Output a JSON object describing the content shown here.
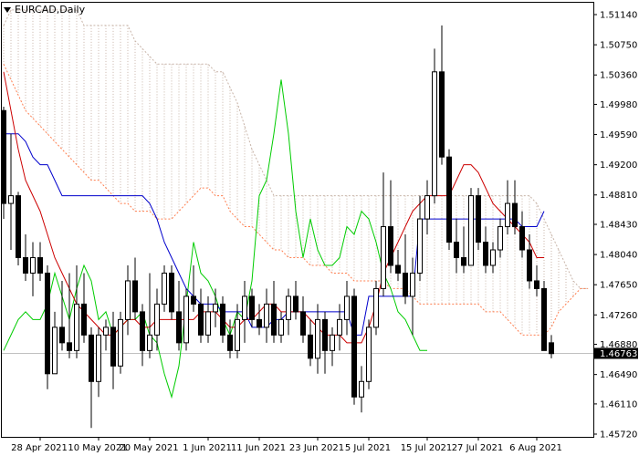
{
  "header": {
    "symbol_label": "EURCAD,Daily"
  },
  "colors": {
    "background": "#ffffff",
    "frame": "#000000",
    "bull_fill": "#ffffff",
    "bear_fill": "#000000",
    "tenkan": "#cc0000",
    "kijun": "#0000cc",
    "chikou": "#00cc00",
    "span_a": "#ff7f50",
    "span_b": "#c8b4a8",
    "current_price_line": "#c0c0c0",
    "current_price_bg": "#000000"
  },
  "chart_data": {
    "type": "candlestick",
    "title": "EURCAD,Daily",
    "indicator": "Ichimoku Kinko Hyo",
    "ylim": [
      1.4572,
      1.5114
    ],
    "y_ticks": [
      "1.51140",
      "1.50750",
      "1.50360",
      "1.49980",
      "1.49590",
      "1.49200",
      "1.48810",
      "1.48430",
      "1.48040",
      "1.47650",
      "1.47260",
      "1.46880",
      "1.46490",
      "1.46110",
      "1.45720"
    ],
    "current_price": "1.46763",
    "x_ticks": [
      "28 Apr 2021",
      "10 May 2021",
      "20 May 2021",
      "1 Jun 2021",
      "11 Jun 2021",
      "23 Jun 2021",
      "5 Jul 2021",
      "15 Jul 2021",
      "27 Jul 2021",
      "6 Aug 2021"
    ],
    "x_tick_bars": [
      5,
      13,
      20,
      28,
      35,
      43,
      50,
      58,
      65,
      73
    ],
    "candles": [
      [
        1.499,
        1.4995,
        1.485,
        1.487
      ],
      [
        1.487,
        1.496,
        1.481,
        1.488
      ],
      [
        1.488,
        1.4885,
        1.479,
        1.48
      ],
      [
        1.48,
        1.483,
        1.477,
        1.478
      ],
      [
        1.478,
        1.482,
        1.475,
        1.48
      ],
      [
        1.48,
        1.482,
        1.477,
        1.478
      ],
      [
        1.478,
        1.479,
        1.463,
        1.465
      ],
      [
        1.465,
        1.473,
        1.465,
        1.471
      ],
      [
        1.471,
        1.477,
        1.468,
        1.469
      ],
      [
        1.469,
        1.478,
        1.467,
        1.468
      ],
      [
        1.468,
        1.479,
        1.467,
        1.474
      ],
      [
        1.474,
        1.478,
        1.469,
        1.47
      ],
      [
        1.47,
        1.471,
        1.458,
        1.464
      ],
      [
        1.464,
        1.471,
        1.462,
        1.47
      ],
      [
        1.47,
        1.472,
        1.468,
        1.471
      ],
      [
        1.471,
        1.473,
        1.463,
        1.466
      ],
      [
        1.466,
        1.473,
        1.465,
        1.472
      ],
      [
        1.472,
        1.479,
        1.47,
        1.477
      ],
      [
        1.477,
        1.48,
        1.472,
        1.473
      ],
      [
        1.473,
        1.474,
        1.466,
        1.468
      ],
      [
        1.468,
        1.478,
        1.467,
        1.47
      ],
      [
        1.47,
        1.476,
        1.468,
        1.474
      ],
      [
        1.474,
        1.479,
        1.473,
        1.478
      ],
      [
        1.478,
        1.479,
        1.472,
        1.473
      ],
      [
        1.473,
        1.477,
        1.468,
        1.469
      ],
      [
        1.469,
        1.476,
        1.468,
        1.475
      ],
      [
        1.475,
        1.479,
        1.473,
        1.474
      ],
      [
        1.474,
        1.476,
        1.469,
        1.47
      ],
      [
        1.47,
        1.475,
        1.469,
        1.473
      ],
      [
        1.473,
        1.476,
        1.471,
        1.474
      ],
      [
        1.474,
        1.475,
        1.469,
        1.47
      ],
      [
        1.47,
        1.472,
        1.467,
        1.468
      ],
      [
        1.468,
        1.474,
        1.467,
        1.472
      ],
      [
        1.472,
        1.477,
        1.469,
        1.475
      ],
      [
        1.475,
        1.476,
        1.471,
        1.472
      ],
      [
        1.472,
        1.474,
        1.47,
        1.471
      ],
      [
        1.471,
        1.476,
        1.469,
        1.474
      ],
      [
        1.474,
        1.477,
        1.469,
        1.47
      ],
      [
        1.47,
        1.473,
        1.469,
        1.472
      ],
      [
        1.472,
        1.476,
        1.47,
        1.475
      ],
      [
        1.475,
        1.477,
        1.472,
        1.473
      ],
      [
        1.473,
        1.475,
        1.469,
        1.47
      ],
      [
        1.47,
        1.472,
        1.466,
        1.467
      ],
      [
        1.467,
        1.474,
        1.465,
        1.472
      ],
      [
        1.472,
        1.473,
        1.465,
        1.468
      ],
      [
        1.468,
        1.471,
        1.466,
        1.47
      ],
      [
        1.47,
        1.474,
        1.468,
        1.472
      ],
      [
        1.472,
        1.477,
        1.47,
        1.475
      ],
      [
        1.475,
        1.476,
        1.461,
        1.462
      ],
      [
        1.462,
        1.466,
        1.46,
        1.464
      ],
      [
        1.464,
        1.472,
        1.463,
        1.471
      ],
      [
        1.471,
        1.477,
        1.47,
        1.476
      ],
      [
        1.476,
        1.491,
        1.475,
        1.484
      ],
      [
        1.484,
        1.49,
        1.478,
        1.479
      ],
      [
        1.479,
        1.481,
        1.477,
        1.478
      ],
      [
        1.478,
        1.483,
        1.474,
        1.475
      ],
      [
        1.475,
        1.48,
        1.47,
        1.478
      ],
      [
        1.478,
        1.488,
        1.477,
        1.485
      ],
      [
        1.485,
        1.49,
        1.483,
        1.488
      ],
      [
        1.488,
        1.507,
        1.487,
        1.504
      ],
      [
        1.504,
        1.51,
        1.492,
        1.493
      ],
      [
        1.493,
        1.494,
        1.481,
        1.482
      ],
      [
        1.482,
        1.485,
        1.478,
        1.48
      ],
      [
        1.48,
        1.484,
        1.478,
        1.479
      ],
      [
        1.479,
        1.489,
        1.479,
        1.488
      ],
      [
        1.488,
        1.489,
        1.481,
        1.482
      ],
      [
        1.482,
        1.484,
        1.478,
        1.479
      ],
      [
        1.479,
        1.482,
        1.478,
        1.481
      ],
      [
        1.481,
        1.485,
        1.48,
        1.484
      ],
      [
        1.484,
        1.49,
        1.483,
        1.487
      ],
      [
        1.487,
        1.49,
        1.483,
        1.484
      ],
      [
        1.484,
        1.486,
        1.48,
        1.481
      ],
      [
        1.481,
        1.483,
        1.476,
        1.477
      ],
      [
        1.477,
        1.479,
        1.475,
        1.476
      ],
      [
        1.476,
        1.477,
        1.468,
        1.468
      ],
      [
        1.469,
        1.47,
        1.467,
        1.4676
      ]
    ],
    "tenkan": [
      1.504,
      1.499,
      1.494,
      1.49,
      1.488,
      1.486,
      1.483,
      1.48,
      1.478,
      1.476,
      1.474,
      1.473,
      1.472,
      1.471,
      1.47,
      1.47,
      1.471,
      1.472,
      1.472,
      1.471,
      1.471,
      1.472,
      1.472,
      1.472,
      1.472,
      1.472,
      1.472,
      1.473,
      1.473,
      1.473,
      1.472,
      1.471,
      1.471,
      1.472,
      1.472,
      1.473,
      1.474,
      1.474,
      1.473,
      1.473,
      1.473,
      1.473,
      1.472,
      1.471,
      1.47,
      1.47,
      1.47,
      1.469,
      1.469,
      1.469,
      1.471,
      1.474,
      1.478,
      1.48,
      1.482,
      1.484,
      1.486,
      1.487,
      1.488,
      1.488,
      1.488,
      1.488,
      1.49,
      1.492,
      1.492,
      1.491,
      1.489,
      1.487,
      1.486,
      1.485,
      1.484,
      1.483,
      1.482,
      1.48,
      1.48
    ],
    "kijun": [
      1.496,
      1.496,
      1.496,
      1.495,
      1.493,
      1.492,
      1.492,
      1.49,
      1.488,
      1.488,
      1.488,
      1.488,
      1.488,
      1.488,
      1.488,
      1.488,
      1.488,
      1.488,
      1.488,
      1.488,
      1.487,
      1.485,
      1.482,
      1.48,
      1.478,
      1.476,
      1.475,
      1.474,
      1.474,
      1.474,
      1.473,
      1.473,
      1.473,
      1.473,
      1.471,
      1.471,
      1.471,
      1.472,
      1.472,
      1.473,
      1.473,
      1.473,
      1.473,
      1.473,
      1.473,
      1.473,
      1.473,
      1.473,
      1.47,
      1.47,
      1.475,
      1.475,
      1.475,
      1.475,
      1.475,
      1.475,
      1.475,
      1.485,
      1.485,
      1.485,
      1.485,
      1.485,
      1.485,
      1.485,
      1.485,
      1.485,
      1.485,
      1.485,
      1.485,
      1.485,
      1.485,
      1.484,
      1.484,
      1.484,
      1.486
    ],
    "chikou": [
      1.468,
      1.47,
      1.472,
      1.473,
      1.472,
      1.472,
      1.474,
      1.478,
      1.475,
      1.472,
      1.476,
      1.479,
      1.477,
      1.472,
      1.473,
      1.47,
      1.471,
      1.472,
      1.472,
      1.473,
      1.47,
      1.469,
      1.465,
      1.462,
      1.466,
      1.474,
      1.482,
      1.478,
      1.477,
      1.475,
      1.472,
      1.47,
      1.473,
      1.472,
      1.477,
      1.488,
      1.49,
      1.496,
      1.503,
      1.496,
      1.486,
      1.48,
      1.485,
      1.481,
      1.479,
      1.479,
      1.48,
      1.484,
      1.483,
      1.486,
      1.485,
      1.482,
      1.478,
      1.476,
      1.473,
      1.472,
      1.47,
      1.468,
      1.468
    ],
    "span_a": [
      1.505,
      1.503,
      1.501,
      1.499,
      1.498,
      1.497,
      1.496,
      1.495,
      1.494,
      1.493,
      1.492,
      1.491,
      1.49,
      1.49,
      1.489,
      1.488,
      1.487,
      1.487,
      1.486,
      1.486,
      1.486,
      1.485,
      1.485,
      1.485,
      1.486,
      1.487,
      1.488,
      1.489,
      1.489,
      1.488,
      1.488,
      1.486,
      1.485,
      1.484,
      1.484,
      1.483,
      1.482,
      1.481,
      1.481,
      1.48,
      1.48,
      1.48,
      1.479,
      1.479,
      1.479,
      1.478,
      1.478,
      1.478,
      1.477,
      1.477,
      1.477,
      1.477,
      1.477,
      1.476,
      1.476,
      1.476,
      1.475,
      1.474,
      1.474,
      1.474,
      1.474,
      1.474,
      1.474,
      1.474,
      1.474,
      1.474,
      1.473,
      1.473,
      1.473,
      1.472,
      1.471,
      1.47,
      1.47,
      1.47,
      1.47,
      1.471,
      1.473,
      1.474,
      1.475,
      1.476,
      1.476,
      1.476
    ],
    "span_b": [
      1.51,
      1.512,
      1.512,
      1.512,
      1.512,
      1.512,
      1.512,
      1.512,
      1.512,
      1.512,
      1.512,
      1.51,
      1.51,
      1.51,
      1.51,
      1.51,
      1.51,
      1.51,
      1.508,
      1.507,
      1.506,
      1.505,
      1.505,
      1.505,
      1.505,
      1.505,
      1.505,
      1.505,
      1.505,
      1.504,
      1.504,
      1.502,
      1.5,
      1.497,
      1.494,
      1.492,
      1.49,
      1.488,
      1.488,
      1.488,
      1.488,
      1.488,
      1.488,
      1.488,
      1.488,
      1.488,
      1.488,
      1.488,
      1.488,
      1.488,
      1.488,
      1.488,
      1.488,
      1.488,
      1.488,
      1.488,
      1.488,
      1.488,
      1.488,
      1.488,
      1.488,
      1.488,
      1.488,
      1.488,
      1.488,
      1.488,
      1.488,
      1.488,
      1.488,
      1.488,
      1.488,
      1.488,
      1.488,
      1.487,
      1.485,
      1.483,
      1.481,
      1.479,
      1.477,
      1.476,
      1.476,
      1.476
    ]
  }
}
